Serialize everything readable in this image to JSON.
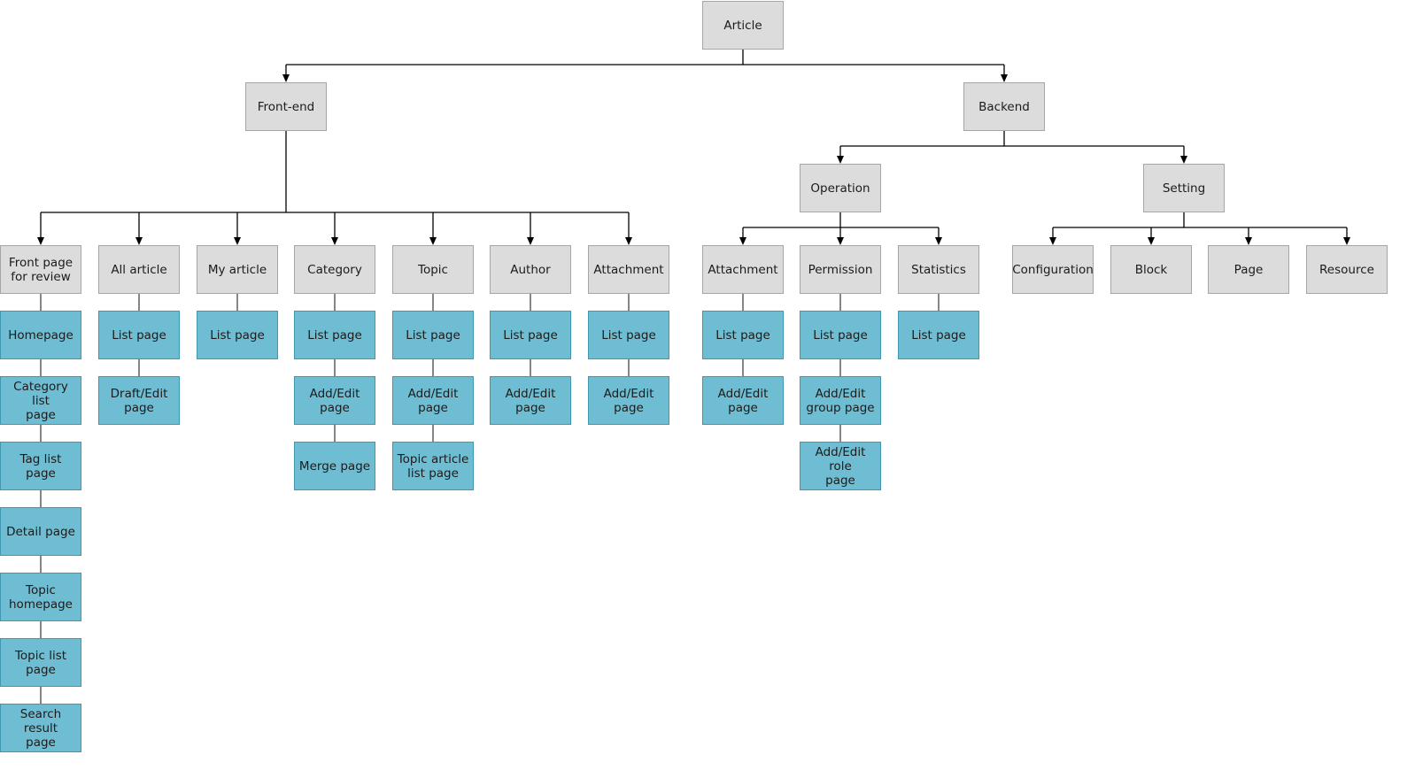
{
  "diagram": {
    "title": "Article",
    "colors": {
      "category_fill": "#dcdcdc",
      "page_fill": "#6fbdd3",
      "line": "#000000"
    },
    "root": {
      "label": "Article",
      "children": [
        {
          "label": "Front-end",
          "children": [
            {
              "label": "Front page\nfor review",
              "pages": [
                "Homepage",
                "Category list\npage",
                "Tag list page",
                "Detail page",
                "Topic\nhomepage",
                "Topic list\npage",
                "Search result\npage"
              ]
            },
            {
              "label": "All article",
              "pages": [
                "List page",
                "Draft/Edit\npage"
              ]
            },
            {
              "label": "My article",
              "pages": [
                "List page"
              ]
            },
            {
              "label": "Category",
              "pages": [
                "List page",
                "Add/Edit\npage",
                "Merge page"
              ]
            },
            {
              "label": "Topic",
              "pages": [
                "List page",
                "Add/Edit\npage",
                "Topic article\nlist page"
              ]
            },
            {
              "label": "Author",
              "pages": [
                "List page",
                "Add/Edit\npage"
              ]
            },
            {
              "label": "Attachment",
              "pages": [
                "List page",
                "Add/Edit\npage"
              ]
            }
          ]
        },
        {
          "label": "Backend",
          "children": [
            {
              "label": "Operation",
              "children": [
                {
                  "label": "Attachment",
                  "pages": [
                    "List page",
                    "Add/Edit\npage"
                  ]
                },
                {
                  "label": "Permission",
                  "pages": [
                    "List page",
                    "Add/Edit\ngroup page",
                    "Add/Edit role\npage"
                  ]
                },
                {
                  "label": "Statistics",
                  "pages": [
                    "List page"
                  ]
                }
              ]
            },
            {
              "label": "Setting",
              "children": [
                {
                  "label": "Configuration",
                  "pages": []
                },
                {
                  "label": "Block",
                  "pages": []
                },
                {
                  "label": "Page",
                  "pages": []
                },
                {
                  "label": "Resource",
                  "pages": []
                }
              ]
            }
          ]
        }
      ]
    }
  }
}
